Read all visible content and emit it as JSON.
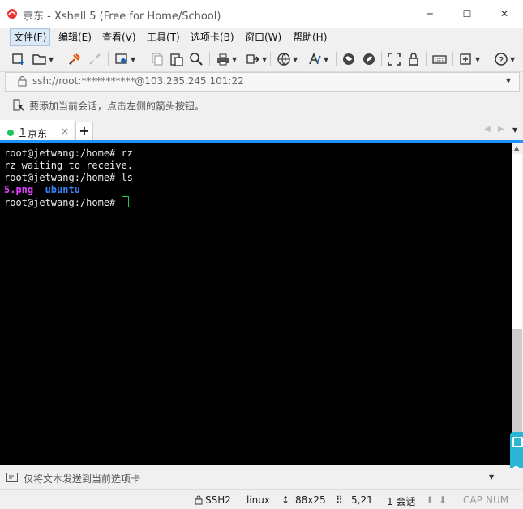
{
  "window": {
    "title": "京东 - Xshell 5 (Free for Home/School)",
    "minimize_glyph": "─",
    "maximize_glyph": "☐",
    "close_glyph": "✕"
  },
  "menu": {
    "items": [
      "文件(F)",
      "编辑(E)",
      "查看(V)",
      "工具(T)",
      "选项卡(B)",
      "窗口(W)",
      "帮助(H)"
    ]
  },
  "toolbar": {
    "icons": [
      "new-session-icon",
      "open-folder-icon",
      "connect-icon",
      "disconnect-icon",
      "properties-icon",
      "copy-icon",
      "paste-icon",
      "find-icon",
      "print-icon",
      "transfer-icon",
      "globe-icon",
      "font-icon",
      "xftp-icon",
      "xmanager-icon",
      "fullscreen-icon",
      "lock-icon",
      "keyboard-icon",
      "add-tab-icon",
      "help-icon"
    ]
  },
  "address": {
    "value": "ssh://root:***********@103.235.245.101:22"
  },
  "hint": {
    "text": "要添加当前会话，点击左侧的箭头按钮。"
  },
  "tabs": {
    "active_index": "1",
    "active_label": "京东",
    "close_glyph": "×",
    "add_glyph": "+",
    "status_color": "#22c55e"
  },
  "terminal": {
    "lines": [
      {
        "prompt": "root@jetwang:/home# ",
        "text": "rz"
      },
      {
        "prompt": "",
        "text": "rz waiting to receive."
      },
      {
        "prompt": "root@jetwang:/home# ",
        "text": "ls"
      }
    ],
    "ls_output": {
      "file_png": "5.png",
      "dir_ubuntu": "ubuntu",
      "file_color": "#e040fb",
      "dir_color": "#3b82f6"
    },
    "current_prompt": "root@jetwang:/home# ",
    "cursor_color": "#22c55e"
  },
  "sendbar": {
    "placeholder": "仅将文本发送到当前选项卡"
  },
  "status": {
    "protocol": "SSH2",
    "terminal_type": "linux",
    "size": "88x25",
    "position": "5,21",
    "sessions": "1 会话",
    "cap": "CAP",
    "num": "NUM"
  }
}
